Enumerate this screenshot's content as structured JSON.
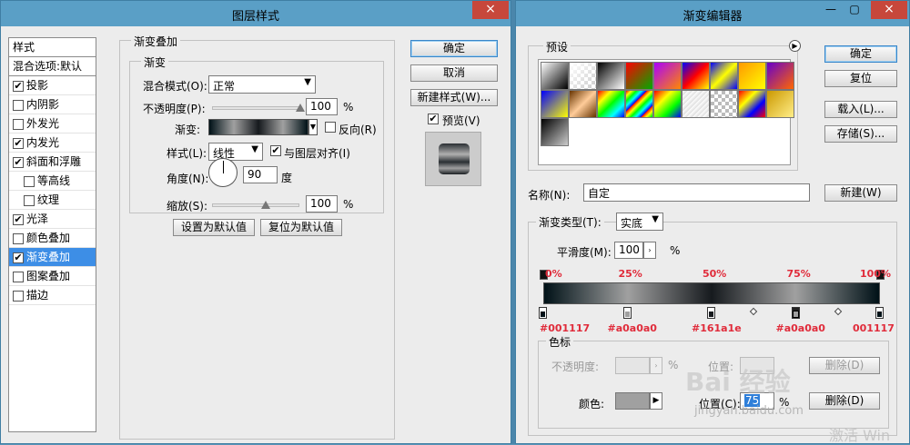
{
  "left_dialog": {
    "title": "图层样式",
    "close_icon": "×",
    "style_list": {
      "header": "样式",
      "blend_options": "混合选项:默认",
      "items": [
        {
          "label": "投影",
          "checked": true
        },
        {
          "label": "内阴影",
          "checked": false
        },
        {
          "label": "外发光",
          "checked": false
        },
        {
          "label": "内发光",
          "checked": true
        },
        {
          "label": "斜面和浮雕",
          "checked": true
        },
        {
          "label": "等高线",
          "checked": false
        },
        {
          "label": "纹理",
          "checked": false
        },
        {
          "label": "光泽",
          "checked": true
        },
        {
          "label": "颜色叠加",
          "checked": false
        },
        {
          "label": "渐变叠加",
          "checked": true
        },
        {
          "label": "图案叠加",
          "checked": false
        },
        {
          "label": "描边",
          "checked": false
        }
      ]
    },
    "panel": {
      "group_title": "渐变叠加",
      "sub_title": "渐变",
      "blend_mode_label": "混合模式(O):",
      "blend_mode_value": "正常",
      "opacity_label": "不透明度(P):",
      "opacity_value": "100",
      "opacity_unit": "%",
      "opacity_level": 1.0,
      "gradient_label": "渐变:",
      "reverse_label": "反向(R)",
      "style_label": "样式(L):",
      "style_value": "线性",
      "align_label": "与图层对齐(I)",
      "angle_label": "角度(N):",
      "angle_value": "90",
      "angle_unit": "度",
      "scale_label": "缩放(S):",
      "scale_value": "100",
      "scale_unit": "%",
      "scale_level": 0.6,
      "set_default": "设置为默认值",
      "reset_default": "复位为默认值"
    },
    "buttons": {
      "ok": "确定",
      "cancel": "取消",
      "new_style": "新建样式(W)...",
      "preview": "预览(V)"
    }
  },
  "right_dialog": {
    "title": "渐变编辑器",
    "presets_label": "预设",
    "buttons": {
      "ok": "确定",
      "reset": "复位",
      "load": "载入(L)...",
      "save": "存储(S)...",
      "new": "新建(W)"
    },
    "name_label": "名称(N):",
    "name_value": "自定",
    "type_label": "渐变类型(T):",
    "type_value": "实底",
    "smooth_label": "平滑度(M):",
    "smooth_value": "100",
    "smooth_unit": "%",
    "location_percent_labels": [
      "0%",
      "25%",
      "50%",
      "75%",
      "100%"
    ],
    "stop_colors": [
      "#001117",
      "#a0a0a0",
      "#161a1e",
      "#a0a0a0",
      "#001117"
    ],
    "stop_labels": [
      "#001117",
      "#a0a0a0",
      "#161a1e",
      "#a0a0a0",
      "001117"
    ],
    "stops_group_label": "色标",
    "opacity_label": "不透明度:",
    "opacity_unit": "%",
    "location_label": "位置:",
    "delete_label": "删除(D)",
    "color_label": "颜色:",
    "color_swatch": "#a0a0a0",
    "location2_label": "位置(C):",
    "location2_value": "75",
    "location2_unit": "%",
    "delete2_label": "删除(D)"
  },
  "watermark": {
    "text1": "Bai 经验",
    "text2": "jingyan.baidu.com",
    "text3": "激活 Win"
  }
}
